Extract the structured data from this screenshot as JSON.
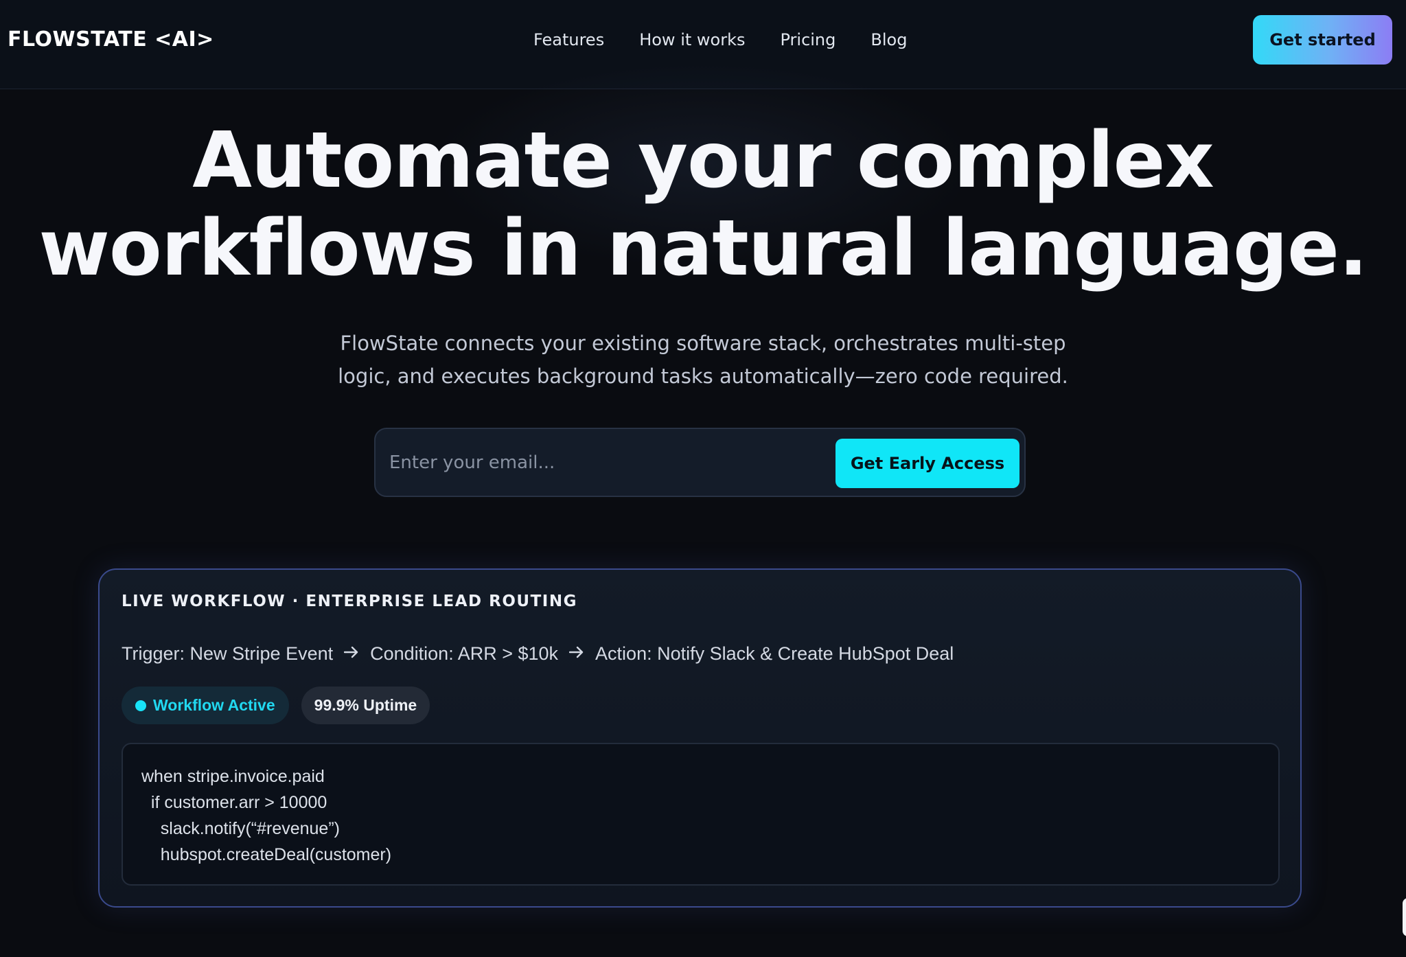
{
  "nav": {
    "logo": "FLOWSTATE <AI>",
    "links": [
      "Features",
      "How it works",
      "Pricing",
      "Blog"
    ],
    "cta_label": "Get started"
  },
  "hero": {
    "title_line1": "Automate your complex",
    "title_line2": "workflows in natural language.",
    "subtitle": "FlowState connects your existing software stack, orchestrates multi-step logic, and executes background tasks automatically—zero code required."
  },
  "signup": {
    "email_placeholder": "Enter your email...",
    "email_value": "",
    "button_label": "Get Early Access"
  },
  "workflow_card": {
    "kicker": "LIVE WORKFLOW · ENTERPRISE LEAD ROUTING",
    "steps": [
      "Trigger: New Stripe Event",
      "Condition: ARR > $10k",
      "Action: Notify Slack & Create HubSpot Deal"
    ],
    "arrow_icon": "arrow-right-icon",
    "status_badge": "Workflow Active",
    "uptime_badge": "99.9% Uptime",
    "code_lines": [
      "when stripe.invoice.paid",
      "  if customer.arr > 10000",
      "    slack.notify(“#revenue”)",
      "    hubspot.createDeal(customer)"
    ]
  },
  "colors": {
    "background": "#0a0c11",
    "accent_cyan": "#10e6f7",
    "accent_violet": "#8c7df4",
    "card_border": "#3a4a8c"
  }
}
